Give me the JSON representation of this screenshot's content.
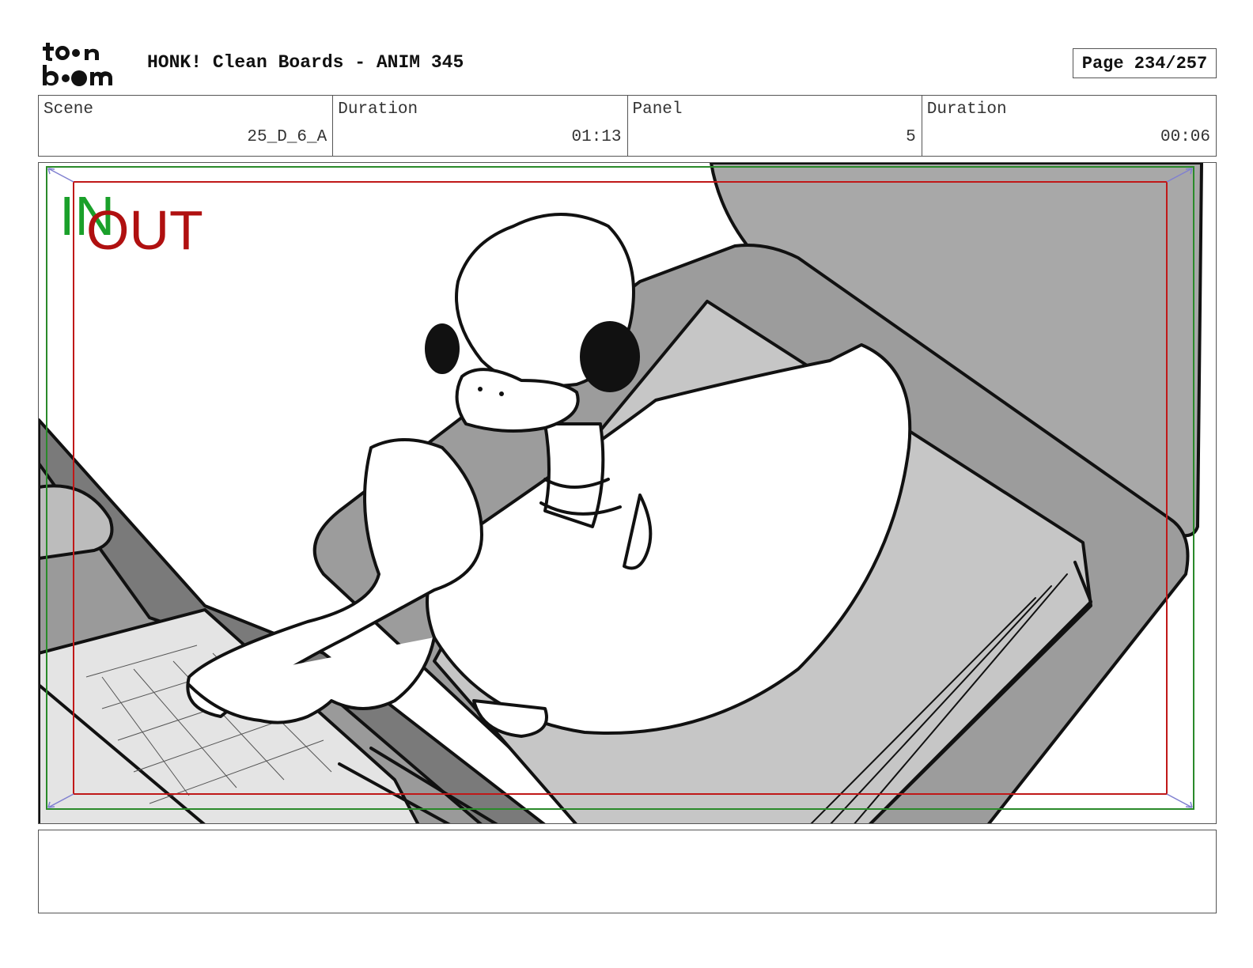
{
  "header": {
    "title": "HONK! Clean Boards - ANIM 345",
    "page": "Page 234/257",
    "logo_text": "toonboom"
  },
  "info": {
    "scene_label": "Scene",
    "scene_value": "25_D_6_A",
    "scene_duration_label": "Duration",
    "scene_duration_value": "01:13",
    "panel_label": "Panel",
    "panel_value": "5",
    "panel_duration_label": "Duration",
    "panel_duration_value": "00:06"
  },
  "panel": {
    "in_marker": "IN",
    "out_marker": "OUT",
    "colors": {
      "in_frame": "#2a8a2a",
      "out_frame": "#c01818",
      "corner_arrows": "#8080d0"
    }
  },
  "notes": {
    "text": ""
  }
}
